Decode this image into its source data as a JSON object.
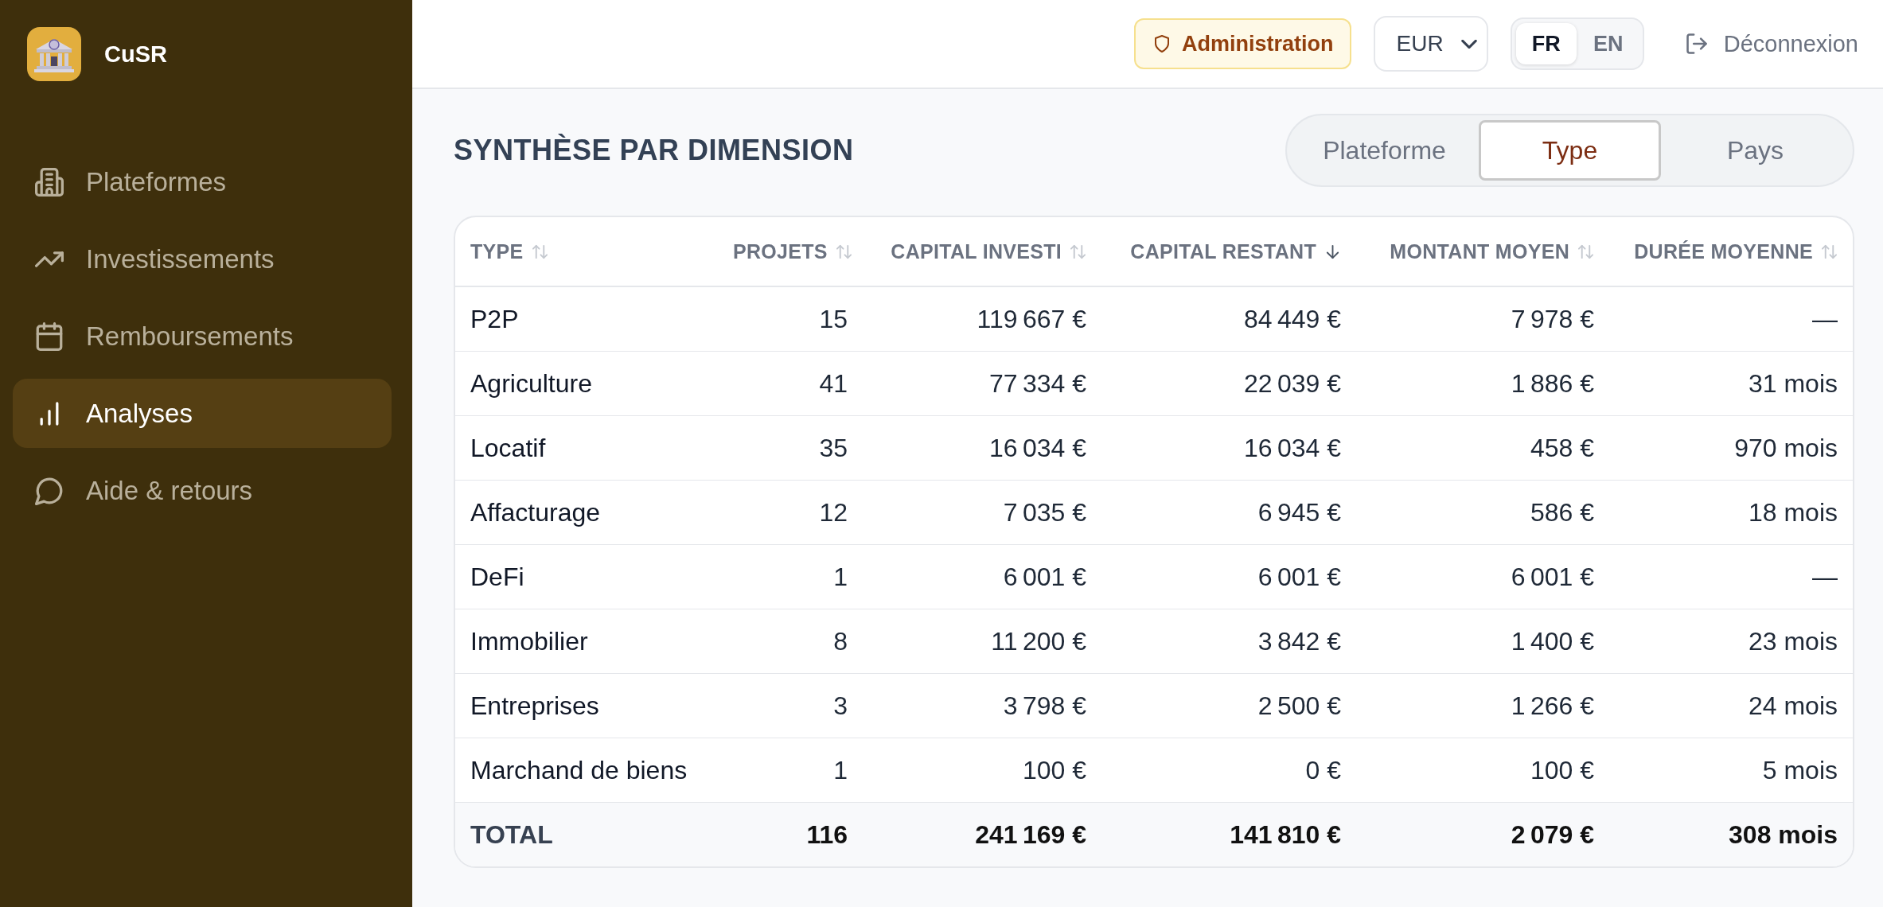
{
  "sidebar": {
    "app_name": "CuSR",
    "items": [
      {
        "label": "Plateformes",
        "selected": false
      },
      {
        "label": "Investissements",
        "selected": false
      },
      {
        "label": "Remboursements",
        "selected": false
      },
      {
        "label": "Analyses",
        "selected": true
      },
      {
        "label": "Aide & retours",
        "selected": false
      }
    ]
  },
  "topbar": {
    "admin_button": "Administration",
    "currency_select": {
      "value": "EUR"
    },
    "language_toggle": [
      {
        "label": "FR",
        "selected": true
      },
      {
        "label": "EN",
        "selected": false
      }
    ],
    "logout_button": "Déconnexion"
  },
  "section": {
    "title": "SYNTHÈSE PAR DIMENSION",
    "dimension_tabs": [
      {
        "label": "Plateforme",
        "selected": false
      },
      {
        "label": "Type",
        "selected": true
      },
      {
        "label": "Pays",
        "selected": false
      }
    ]
  },
  "table": {
    "columns": [
      {
        "label": "TYPE",
        "sorted": false
      },
      {
        "label": "PROJETS",
        "sorted": false
      },
      {
        "label": "CAPITAL INVESTI",
        "sorted": false
      },
      {
        "label": "CAPITAL RESTANT",
        "sorted": true
      },
      {
        "label": "MONTANT MOYEN",
        "sorted": false
      },
      {
        "label": "DURÉE MOYENNE",
        "sorted": false
      }
    ],
    "rows": [
      [
        "P2P",
        "15",
        "119 667 €",
        "84 449 €",
        "7 978 €",
        "—"
      ],
      [
        "Agriculture",
        "41",
        "77 334 €",
        "22 039 €",
        "1 886 €",
        "31 mois"
      ],
      [
        "Locatif",
        "35",
        "16 034 €",
        "16 034 €",
        "458 €",
        "970 mois"
      ],
      [
        "Affacturage",
        "12",
        "7 035 €",
        "6 945 €",
        "586 €",
        "18 mois"
      ],
      [
        "DeFi",
        "1",
        "6 001 €",
        "6 001 €",
        "6 001 €",
        "—"
      ],
      [
        "Immobilier",
        "8",
        "11 200 €",
        "3 842 €",
        "1 400 €",
        "23 mois"
      ],
      [
        "Entreprises",
        "3",
        "3 798 €",
        "2 500 €",
        "1 266 €",
        "24 mois"
      ],
      [
        "Marchand de biens",
        "1",
        "100 €",
        "0 €",
        "100 €",
        "5 mois"
      ]
    ],
    "total": [
      "TOTAL",
      "116",
      "241 169 €",
      "141 810 €",
      "2 079 €",
      "308 mois"
    ]
  }
}
